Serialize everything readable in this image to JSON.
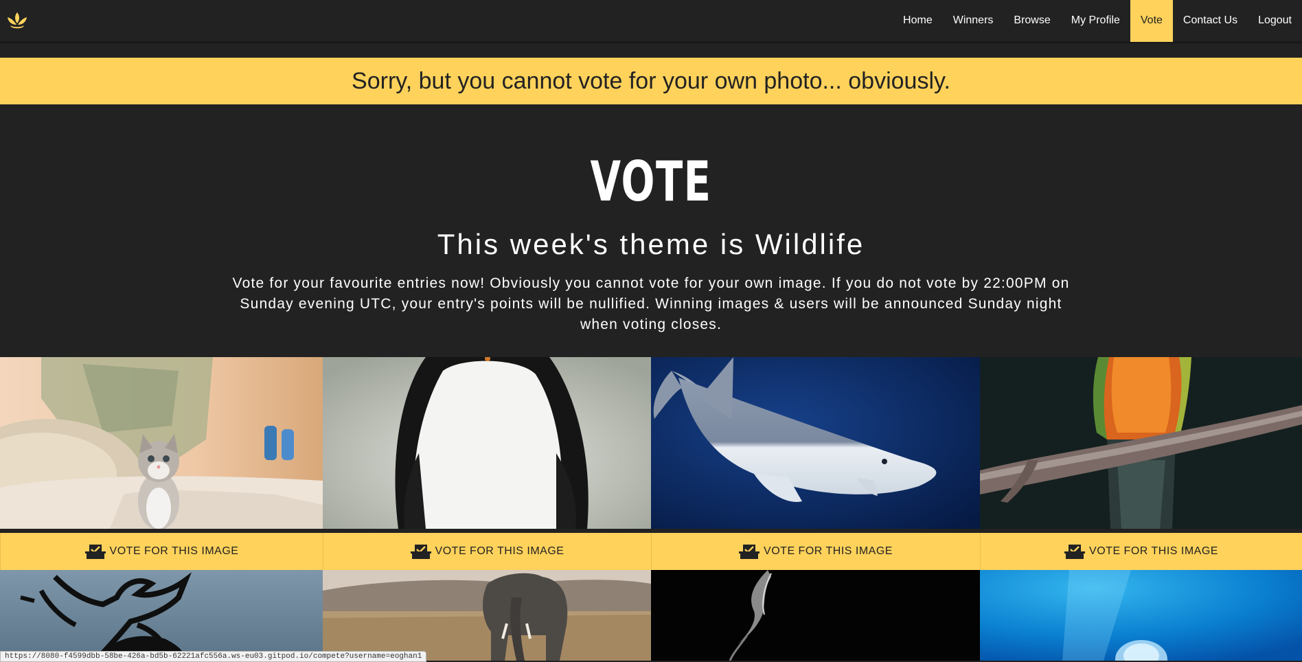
{
  "nav": {
    "logo_icon": "lotus-logo-icon",
    "links": [
      {
        "label": "Home"
      },
      {
        "label": "Winners"
      },
      {
        "label": "Browse"
      },
      {
        "label": "My Profile"
      },
      {
        "label": "Vote",
        "active": true
      },
      {
        "label": "Contact Us"
      },
      {
        "label": "Logout"
      }
    ]
  },
  "alert": {
    "message": "Sorry, but you cannot vote for your own photo... obviously."
  },
  "hero": {
    "title": "VOTE",
    "subtitle": "This week's theme is Wildlife",
    "description": "Vote for your favourite entries now! Obviously you cannot vote for your own image. If you do not vote by 22:00PM on Sunday evening UTC, your entry's points will be nullified. Winning images & users will be announced Sunday night when voting closes."
  },
  "gallery": {
    "vote_label": "VOTE FOR THIS IMAGE",
    "vote_icon": "ballot-box-check-icon",
    "entries": [
      {
        "subject": "kitten-photo"
      },
      {
        "subject": "penguin-photo"
      },
      {
        "subject": "shark-photo"
      },
      {
        "subject": "parrot-photo"
      },
      {
        "subject": "deer-silhouette-photo"
      },
      {
        "subject": "elephant-photo"
      },
      {
        "subject": "water-splash-photo"
      },
      {
        "subject": "jellyfish-photo"
      }
    ]
  },
  "status_bar": {
    "url": "https://8080-f4599dbb-58be-426a-bd5b-62221afc556a.ws-eu03.gitpod.io/compete?username=eoghan1"
  },
  "colors": {
    "accent": "#fed25b",
    "background": "#222222",
    "text_light": "#ffffff"
  }
}
